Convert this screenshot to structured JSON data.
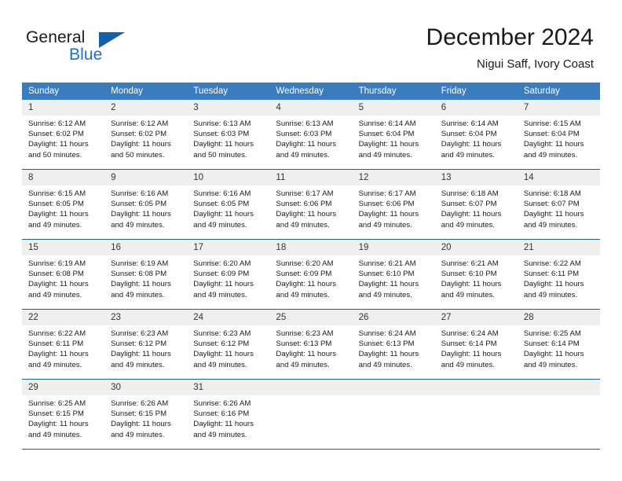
{
  "brand": {
    "name_part1": "General",
    "name_part2": "Blue",
    "flag_icon": "blue-triangle-flag-icon"
  },
  "header": {
    "title": "December 2024",
    "subtitle": "Nigui Saff, Ivory Coast"
  },
  "calendar": {
    "weekday_headers": [
      "Sunday",
      "Monday",
      "Tuesday",
      "Wednesday",
      "Thursday",
      "Friday",
      "Saturday"
    ],
    "accent_color": "#3b7cbf",
    "border_color": "#1560a8",
    "daynum_bg": "#efefef",
    "weeks": [
      [
        {
          "day": "1",
          "sunrise": "Sunrise: 6:12 AM",
          "sunset": "Sunset: 6:02 PM",
          "daylight_line1": "Daylight: 11 hours",
          "daylight_line2": "and 50 minutes."
        },
        {
          "day": "2",
          "sunrise": "Sunrise: 6:12 AM",
          "sunset": "Sunset: 6:02 PM",
          "daylight_line1": "Daylight: 11 hours",
          "daylight_line2": "and 50 minutes."
        },
        {
          "day": "3",
          "sunrise": "Sunrise: 6:13 AM",
          "sunset": "Sunset: 6:03 PM",
          "daylight_line1": "Daylight: 11 hours",
          "daylight_line2": "and 50 minutes."
        },
        {
          "day": "4",
          "sunrise": "Sunrise: 6:13 AM",
          "sunset": "Sunset: 6:03 PM",
          "daylight_line1": "Daylight: 11 hours",
          "daylight_line2": "and 49 minutes."
        },
        {
          "day": "5",
          "sunrise": "Sunrise: 6:14 AM",
          "sunset": "Sunset: 6:04 PM",
          "daylight_line1": "Daylight: 11 hours",
          "daylight_line2": "and 49 minutes."
        },
        {
          "day": "6",
          "sunrise": "Sunrise: 6:14 AM",
          "sunset": "Sunset: 6:04 PM",
          "daylight_line1": "Daylight: 11 hours",
          "daylight_line2": "and 49 minutes."
        },
        {
          "day": "7",
          "sunrise": "Sunrise: 6:15 AM",
          "sunset": "Sunset: 6:04 PM",
          "daylight_line1": "Daylight: 11 hours",
          "daylight_line2": "and 49 minutes."
        }
      ],
      [
        {
          "day": "8",
          "sunrise": "Sunrise: 6:15 AM",
          "sunset": "Sunset: 6:05 PM",
          "daylight_line1": "Daylight: 11 hours",
          "daylight_line2": "and 49 minutes."
        },
        {
          "day": "9",
          "sunrise": "Sunrise: 6:16 AM",
          "sunset": "Sunset: 6:05 PM",
          "daylight_line1": "Daylight: 11 hours",
          "daylight_line2": "and 49 minutes."
        },
        {
          "day": "10",
          "sunrise": "Sunrise: 6:16 AM",
          "sunset": "Sunset: 6:05 PM",
          "daylight_line1": "Daylight: 11 hours",
          "daylight_line2": "and 49 minutes."
        },
        {
          "day": "11",
          "sunrise": "Sunrise: 6:17 AM",
          "sunset": "Sunset: 6:06 PM",
          "daylight_line1": "Daylight: 11 hours",
          "daylight_line2": "and 49 minutes."
        },
        {
          "day": "12",
          "sunrise": "Sunrise: 6:17 AM",
          "sunset": "Sunset: 6:06 PM",
          "daylight_line1": "Daylight: 11 hours",
          "daylight_line2": "and 49 minutes."
        },
        {
          "day": "13",
          "sunrise": "Sunrise: 6:18 AM",
          "sunset": "Sunset: 6:07 PM",
          "daylight_line1": "Daylight: 11 hours",
          "daylight_line2": "and 49 minutes."
        },
        {
          "day": "14",
          "sunrise": "Sunrise: 6:18 AM",
          "sunset": "Sunset: 6:07 PM",
          "daylight_line1": "Daylight: 11 hours",
          "daylight_line2": "and 49 minutes."
        }
      ],
      [
        {
          "day": "15",
          "sunrise": "Sunrise: 6:19 AM",
          "sunset": "Sunset: 6:08 PM",
          "daylight_line1": "Daylight: 11 hours",
          "daylight_line2": "and 49 minutes."
        },
        {
          "day": "16",
          "sunrise": "Sunrise: 6:19 AM",
          "sunset": "Sunset: 6:08 PM",
          "daylight_line1": "Daylight: 11 hours",
          "daylight_line2": "and 49 minutes."
        },
        {
          "day": "17",
          "sunrise": "Sunrise: 6:20 AM",
          "sunset": "Sunset: 6:09 PM",
          "daylight_line1": "Daylight: 11 hours",
          "daylight_line2": "and 49 minutes."
        },
        {
          "day": "18",
          "sunrise": "Sunrise: 6:20 AM",
          "sunset": "Sunset: 6:09 PM",
          "daylight_line1": "Daylight: 11 hours",
          "daylight_line2": "and 49 minutes."
        },
        {
          "day": "19",
          "sunrise": "Sunrise: 6:21 AM",
          "sunset": "Sunset: 6:10 PM",
          "daylight_line1": "Daylight: 11 hours",
          "daylight_line2": "and 49 minutes."
        },
        {
          "day": "20",
          "sunrise": "Sunrise: 6:21 AM",
          "sunset": "Sunset: 6:10 PM",
          "daylight_line1": "Daylight: 11 hours",
          "daylight_line2": "and 49 minutes."
        },
        {
          "day": "21",
          "sunrise": "Sunrise: 6:22 AM",
          "sunset": "Sunset: 6:11 PM",
          "daylight_line1": "Daylight: 11 hours",
          "daylight_line2": "and 49 minutes."
        }
      ],
      [
        {
          "day": "22",
          "sunrise": "Sunrise: 6:22 AM",
          "sunset": "Sunset: 6:11 PM",
          "daylight_line1": "Daylight: 11 hours",
          "daylight_line2": "and 49 minutes."
        },
        {
          "day": "23",
          "sunrise": "Sunrise: 6:23 AM",
          "sunset": "Sunset: 6:12 PM",
          "daylight_line1": "Daylight: 11 hours",
          "daylight_line2": "and 49 minutes."
        },
        {
          "day": "24",
          "sunrise": "Sunrise: 6:23 AM",
          "sunset": "Sunset: 6:12 PM",
          "daylight_line1": "Daylight: 11 hours",
          "daylight_line2": "and 49 minutes."
        },
        {
          "day": "25",
          "sunrise": "Sunrise: 6:23 AM",
          "sunset": "Sunset: 6:13 PM",
          "daylight_line1": "Daylight: 11 hours",
          "daylight_line2": "and 49 minutes."
        },
        {
          "day": "26",
          "sunrise": "Sunrise: 6:24 AM",
          "sunset": "Sunset: 6:13 PM",
          "daylight_line1": "Daylight: 11 hours",
          "daylight_line2": "and 49 minutes."
        },
        {
          "day": "27",
          "sunrise": "Sunrise: 6:24 AM",
          "sunset": "Sunset: 6:14 PM",
          "daylight_line1": "Daylight: 11 hours",
          "daylight_line2": "and 49 minutes."
        },
        {
          "day": "28",
          "sunrise": "Sunrise: 6:25 AM",
          "sunset": "Sunset: 6:14 PM",
          "daylight_line1": "Daylight: 11 hours",
          "daylight_line2": "and 49 minutes."
        }
      ],
      [
        {
          "day": "29",
          "sunrise": "Sunrise: 6:25 AM",
          "sunset": "Sunset: 6:15 PM",
          "daylight_line1": "Daylight: 11 hours",
          "daylight_line2": "and 49 minutes."
        },
        {
          "day": "30",
          "sunrise": "Sunrise: 6:26 AM",
          "sunset": "Sunset: 6:15 PM",
          "daylight_line1": "Daylight: 11 hours",
          "daylight_line2": "and 49 minutes."
        },
        {
          "day": "31",
          "sunrise": "Sunrise: 6:26 AM",
          "sunset": "Sunset: 6:16 PM",
          "daylight_line1": "Daylight: 11 hours",
          "daylight_line2": "and 49 minutes."
        },
        {
          "day": "",
          "sunrise": "",
          "sunset": "",
          "daylight_line1": "",
          "daylight_line2": ""
        },
        {
          "day": "",
          "sunrise": "",
          "sunset": "",
          "daylight_line1": "",
          "daylight_line2": ""
        },
        {
          "day": "",
          "sunrise": "",
          "sunset": "",
          "daylight_line1": "",
          "daylight_line2": ""
        },
        {
          "day": "",
          "sunrise": "",
          "sunset": "",
          "daylight_line1": "",
          "daylight_line2": ""
        }
      ]
    ]
  }
}
